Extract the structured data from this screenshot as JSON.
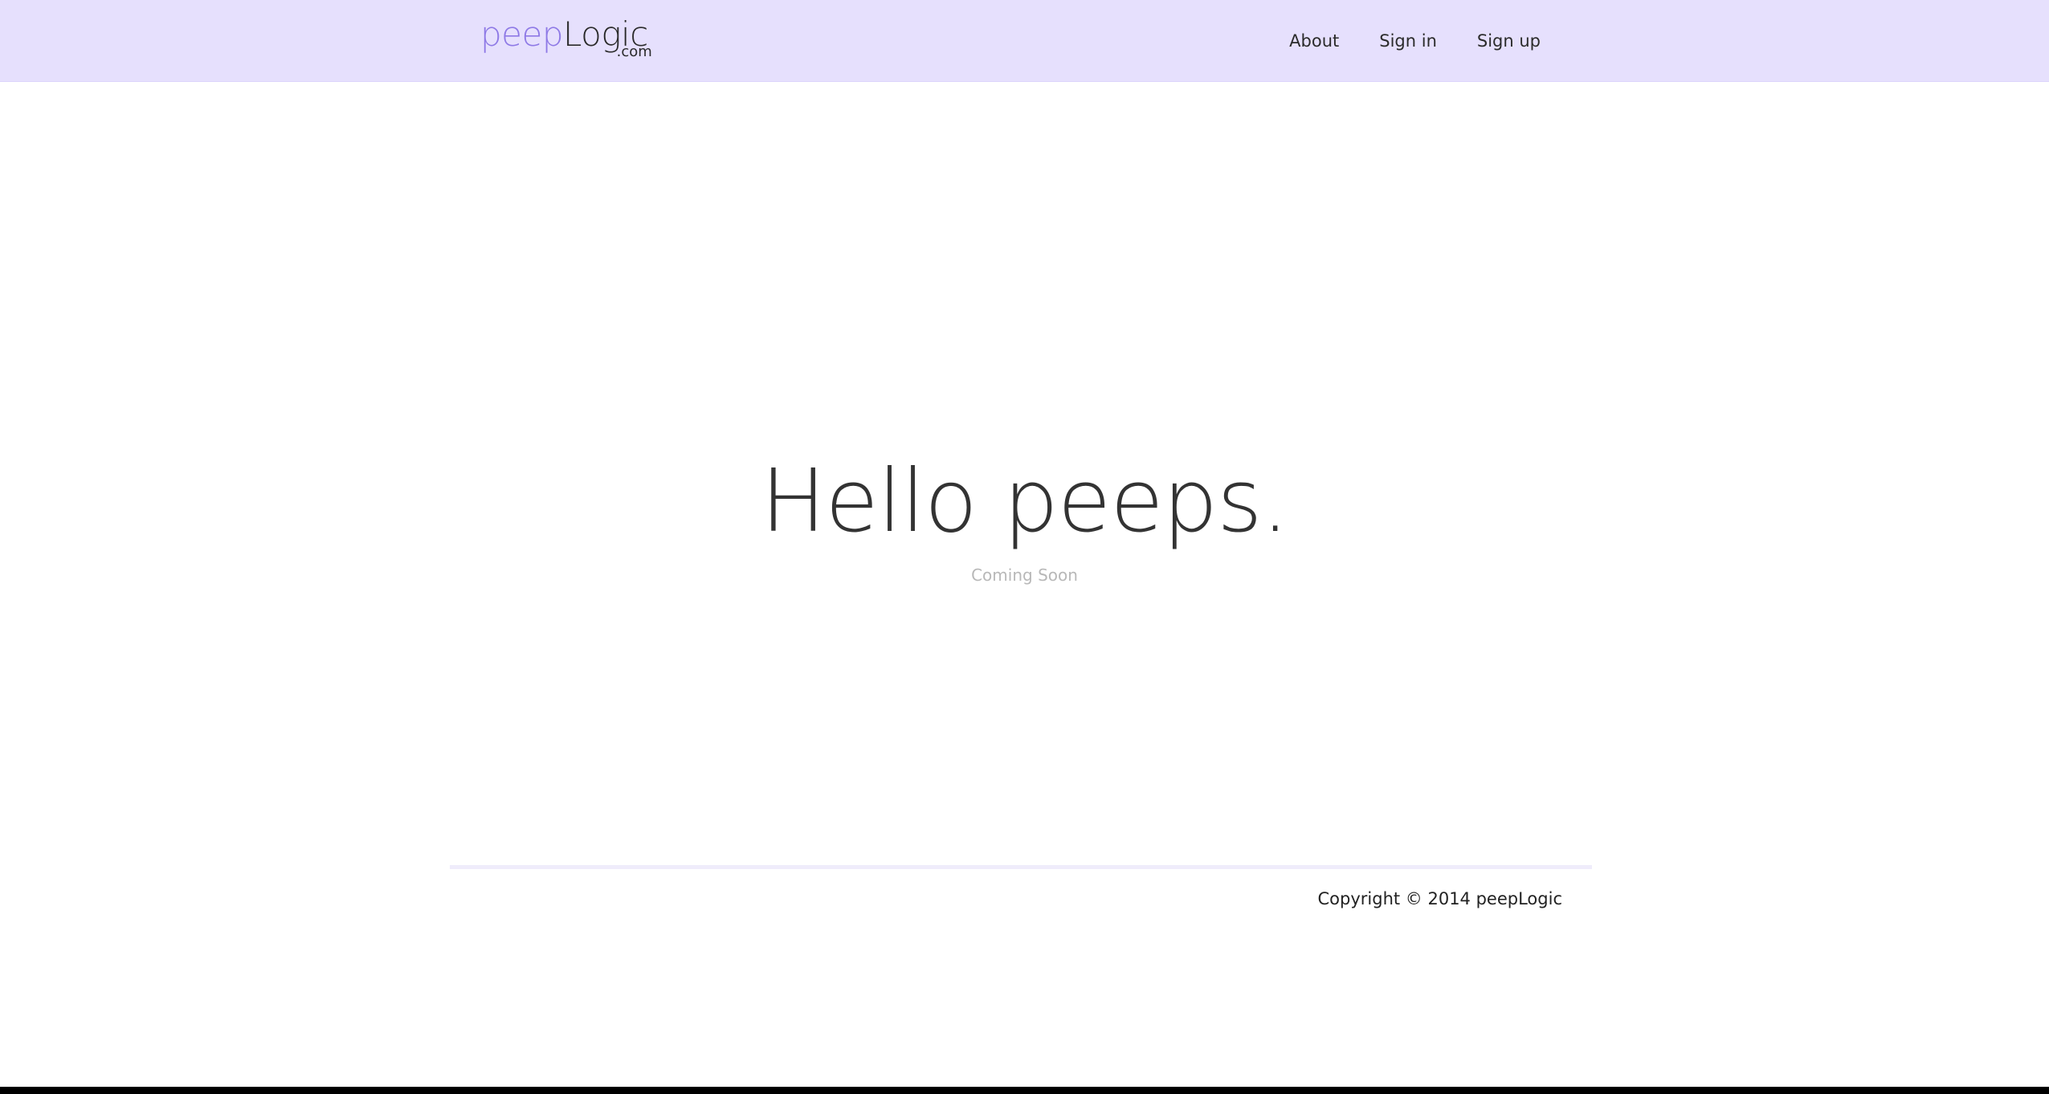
{
  "header": {
    "brand": {
      "part1": "peep",
      "part2": "Logic",
      "tld": ".com"
    },
    "nav": [
      {
        "label": "About"
      },
      {
        "label": "Sign in"
      },
      {
        "label": "Sign up"
      }
    ]
  },
  "hero": {
    "title": "Hello peeps.",
    "subtitle": "Coming Soon"
  },
  "footer": {
    "copyright": "Copyright © 2014 peepLogic"
  },
  "colors": {
    "navbar_background": "#e6e0fd",
    "brand_accent": "#8f7ae6",
    "text_dark": "#333333",
    "subtitle_gray": "#b8b8b8"
  }
}
